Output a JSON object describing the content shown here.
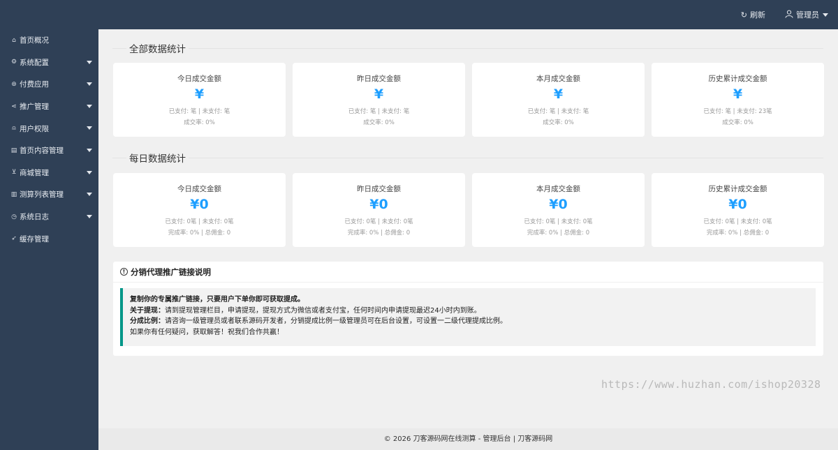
{
  "header": {
    "refresh_icon": "refresh-icon",
    "refresh_label": "刷新",
    "user_icon": "user-icon",
    "user_label": "管理员"
  },
  "sidebar": {
    "items": [
      {
        "label": "首页概况",
        "icon": "home-icon",
        "has_arrow": false
      },
      {
        "label": "系统配置",
        "icon": "gear-icon",
        "has_arrow": true
      },
      {
        "label": "付费应用",
        "icon": "app-icon",
        "has_arrow": true
      },
      {
        "label": "推广管理",
        "icon": "share-icon",
        "has_arrow": true
      },
      {
        "label": "用户权限",
        "icon": "user-icon",
        "has_arrow": true
      },
      {
        "label": "首页内容管理",
        "icon": "content-icon",
        "has_arrow": true
      },
      {
        "label": "商城管理",
        "icon": "cart-icon",
        "has_arrow": true
      },
      {
        "label": "测算列表管理",
        "icon": "list-icon",
        "has_arrow": true
      },
      {
        "label": "系统日志",
        "icon": "clock-icon",
        "has_arrow": true
      },
      {
        "label": "缓存管理",
        "icon": "send-icon",
        "has_arrow": false
      }
    ]
  },
  "all_stats": {
    "title": "全部数据统计",
    "cards": [
      {
        "title": "今日成交金额",
        "value": "¥",
        "line1": "已支付: 笔 | 未支付: 笔",
        "line2": "成交率: 0%"
      },
      {
        "title": "昨日成交金额",
        "value": "¥",
        "line1": "已支付: 笔 | 未支付: 笔",
        "line2": "成交率: 0%"
      },
      {
        "title": "本月成交金额",
        "value": "¥",
        "line1": "已支付: 笔 | 未支付: 笔",
        "line2": "成交率: 0%"
      },
      {
        "title": "历史累计成交金额",
        "value": "¥",
        "line1": "已支付: 笔 | 未支付: 23笔",
        "line2": "成交率: 0%"
      }
    ]
  },
  "daily_stats": {
    "title": "每日数据统计",
    "cards": [
      {
        "title": "今日成交金额",
        "value": "¥0",
        "line1": "已支付: 0笔 | 未支付: 0笔",
        "line2": "完成率: 0% | 总佣金: 0"
      },
      {
        "title": "昨日成交金额",
        "value": "¥0",
        "line1": "已支付: 0笔 | 未支付: 0笔",
        "line2": "完成率: 0% | 总佣金: 0"
      },
      {
        "title": "本月成交金额",
        "value": "¥0",
        "line1": "已支付: 0笔 | 未支付: 0笔",
        "line2": "完成率: 0% | 总佣金: 0"
      },
      {
        "title": "历史累计成交金额",
        "value": "¥0",
        "line1": "已支付: 0笔 | 未支付: 0笔",
        "line2": "完成率: 0% | 总佣金: 0"
      }
    ]
  },
  "notice": {
    "icon": "info-icon",
    "title": "分销代理推广链接说明",
    "line1": "复制你的专属推广链接，只要用户下单你即可获取提成。",
    "line2_label": "关于提现：",
    "line2_text": "请到提现管理栏目，申请提现，提现方式为微信或者支付宝，任何时间内申请提现最迟24小时内到账。",
    "line3_label": "分成比例：",
    "line3_text": "请咨询一级管理员或者联系源码开发者，分销提成比例一级管理员可在后台设置，可设置一二级代理提成比例。",
    "line4": "如果你有任何疑问，获取解答！祝我们合作共赢！"
  },
  "watermark": "https://www.huzhan.com/ishop20328",
  "footer": {
    "text": "© 2026 刀客源码网在线测算 - 管理后台 | 刀客源码网"
  }
}
